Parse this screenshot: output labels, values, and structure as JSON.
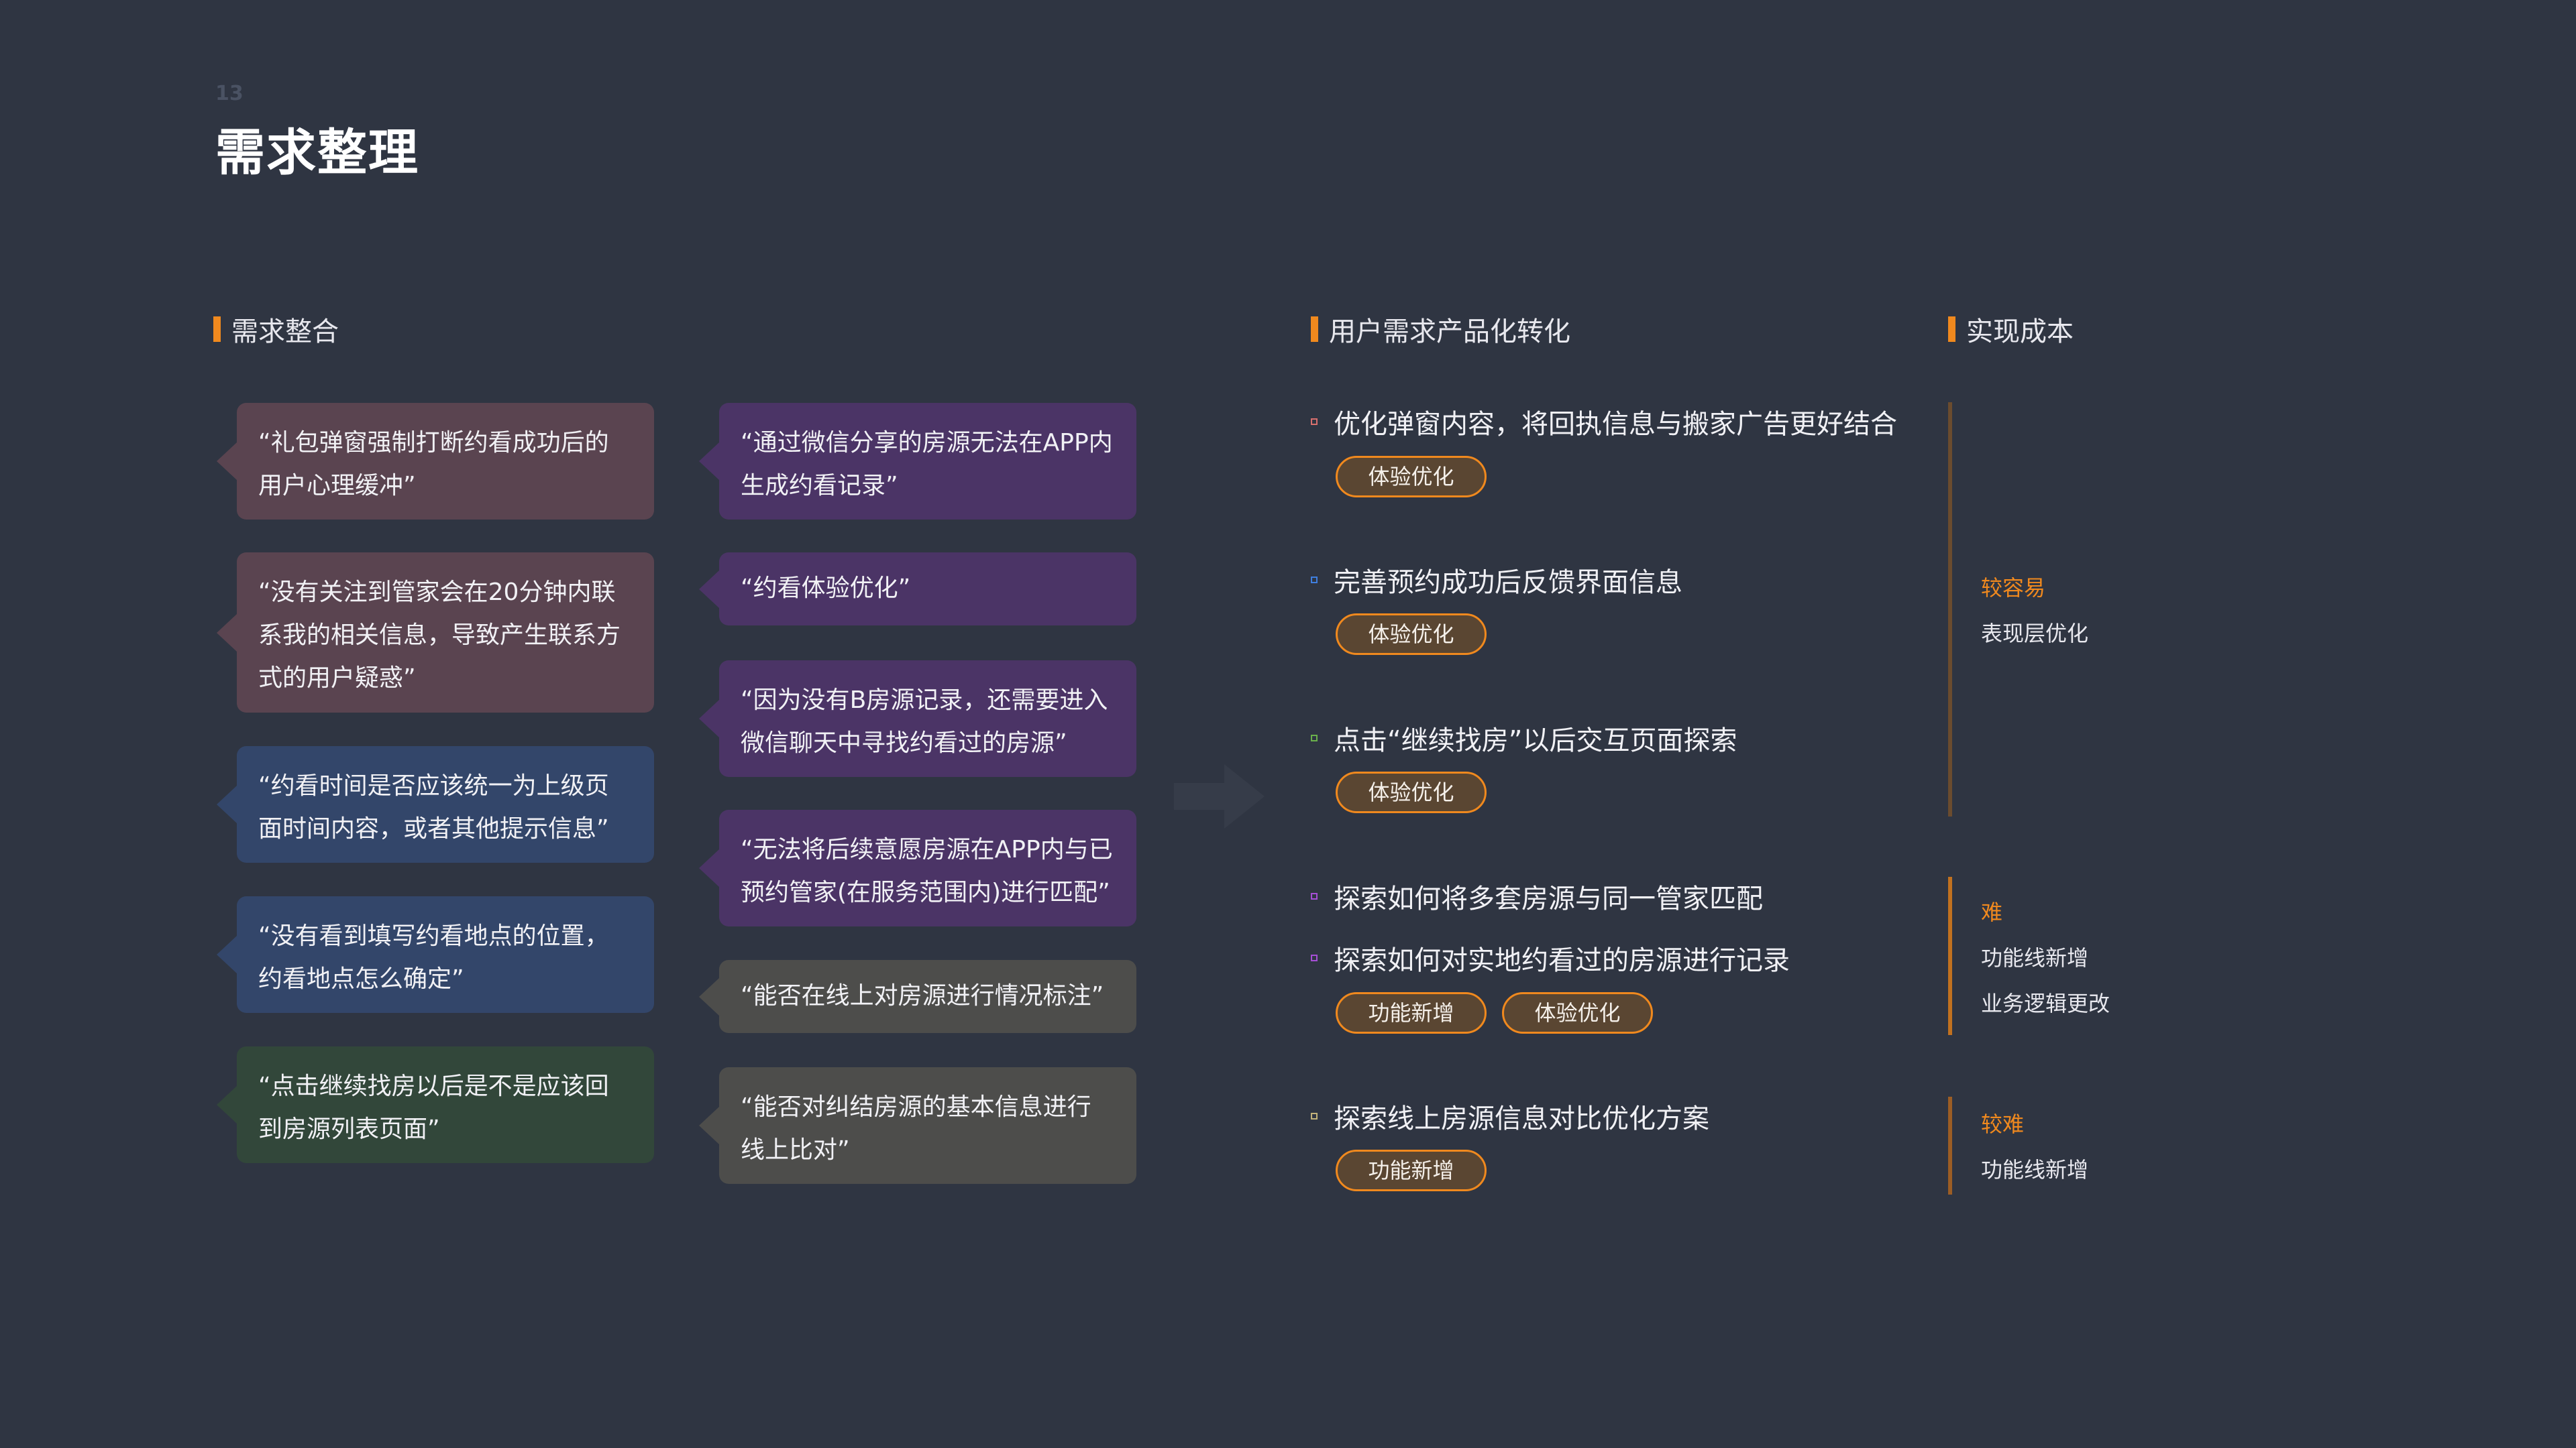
{
  "page": {
    "number": "13",
    "title": "需求整理"
  },
  "sections": {
    "integration": "需求整合",
    "conversion": "用户需求产品化转化",
    "cost": "实现成本"
  },
  "bubbles_left": [
    {
      "text": "“礼包弹窗强制打断约看成功后的用户心理缓冲”",
      "color": "#5a4450"
    },
    {
      "text": "“没有关注到管家会在20分钟内联系我的相关信息，导致产生联系方式的用户疑惑”",
      "color": "#5a4450"
    },
    {
      "text": "“约看时间是否应该统一为上级页面时间内容，或者其他提示信息”",
      "color": "#33466a"
    },
    {
      "text": "“没有看到填写约看地点的位置，约看地点怎么确定”",
      "color": "#33466a"
    },
    {
      "text": "“点击继续找房以后是不是应该回到房源列表页面”",
      "color": "#32473a"
    }
  ],
  "bubbles_right": [
    {
      "text": "“通过微信分享的房源无法在APP内生成约看记录”",
      "color": "#4b3466"
    },
    {
      "text": "“约看体验优化”",
      "color": "#4b3466"
    },
    {
      "text": "“因为没有B房源记录，还需要进入微信聊天中寻找约看过的房源”",
      "color": "#4b3466"
    },
    {
      "text": "“无法将后续意愿房源在APP内与已预约管家(在服务范围内)进行匹配”",
      "color": "#4b3466"
    },
    {
      "text": "“能否在线上对房源进行情况标注”",
      "color": "#4d4d4b"
    },
    {
      "text": "“能否对纠结房源的基本信息进行线上比对”",
      "color": "#4d4d4b"
    }
  ],
  "conversion_items": [
    {
      "text": "优化弹窗内容，将回执信息与搬家广告更好结合",
      "marker_color": "#d8706e",
      "tags": [
        "体验优化"
      ]
    },
    {
      "text": "完善预约成功后反馈界面信息",
      "marker_color": "#3f7fe0",
      "tags": [
        "体验优化"
      ]
    },
    {
      "text": "点击“继续找房”以后交互页面探索",
      "marker_color": "#6ab04c",
      "tags": [
        "体验优化"
      ]
    },
    {
      "text": "探索如何将多套房源与同一管家匹配",
      "marker_color": "#a64fd6",
      "tags": []
    },
    {
      "text": "探索如何对实地约看过的房源进行记录",
      "marker_color": "#a64fd6",
      "tags": [
        "功能新增",
        "体验优化"
      ]
    },
    {
      "text": "探索线上房源信息对比优化方案",
      "marker_color": "#c2b27a",
      "tags": [
        "功能新增"
      ]
    }
  ],
  "costs": [
    {
      "level": "较容易",
      "details": [
        "表现层优化"
      ]
    },
    {
      "level": "难",
      "details": [
        "功能线新增",
        "业务逻辑更改"
      ]
    },
    {
      "level": "较难",
      "details": [
        "功能线新增"
      ]
    }
  ],
  "colors": {
    "background": "#2f3542",
    "accent": "#f0891e"
  },
  "icons": {
    "flow_arrow": "arrow-right-icon"
  }
}
